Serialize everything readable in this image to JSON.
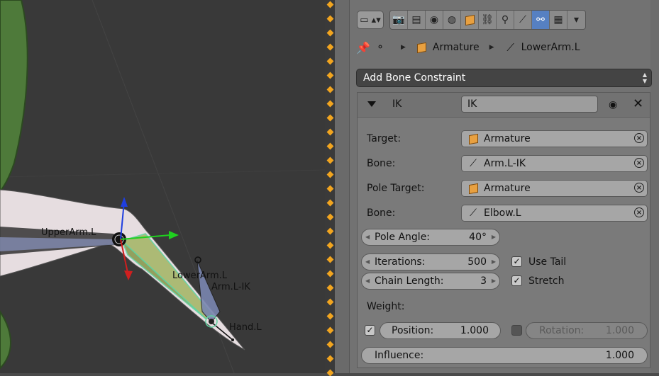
{
  "viewport": {
    "labels": {
      "upper_arm": "UpperArm.L",
      "lower_arm": "LowerArm.L",
      "arm_ik": "Arm.L-IK",
      "hand": "Hand.L"
    }
  },
  "toolbar": {
    "context_icons": [
      "render-icon",
      "render-layers-icon",
      "scene-icon",
      "world-icon",
      "object-icon",
      "constraints-icon",
      "modifiers-icon",
      "data-icon",
      "bone-icon",
      "bone-constraint-icon",
      "material-icon",
      "texture-icon"
    ],
    "active": "bone-constraint-icon"
  },
  "breadcrumb": {
    "object": "Armature",
    "bone": "LowerArm.L"
  },
  "add_constraint": {
    "label": "Add Bone Constraint"
  },
  "constraint": {
    "type_label": "IK",
    "name": "IK",
    "target_label": "Target:",
    "target_value": "Armature",
    "bone_label": "Bone:",
    "bone_value": "Arm.L-IK",
    "pole_target_label": "Pole Target:",
    "pole_target_value": "Armature",
    "pole_bone_label": "Bone:",
    "pole_bone_value": "Elbow.L",
    "pole_angle_label": "Pole Angle:",
    "pole_angle_value": "40°",
    "iterations_label": "Iterations:",
    "iterations_value": "500",
    "chain_length_label": "Chain Length:",
    "chain_length_value": "3",
    "use_tail_label": "Use Tail",
    "use_tail_checked": true,
    "stretch_label": "Stretch",
    "stretch_checked": true,
    "weight_label": "Weight:",
    "position_label": "Position:",
    "position_value": "1.000",
    "position_checked": true,
    "rotation_label": "Rotation:",
    "rotation_value": "1.000",
    "rotation_checked": false,
    "influence_label": "Influence:",
    "influence_value": "1.000"
  },
  "colors": {
    "accent": "#5680c2",
    "viewport_bg": "#393939",
    "panel_bg": "#727272",
    "bone_selected": "#9fd27a",
    "object_orange": "#e8a040"
  }
}
